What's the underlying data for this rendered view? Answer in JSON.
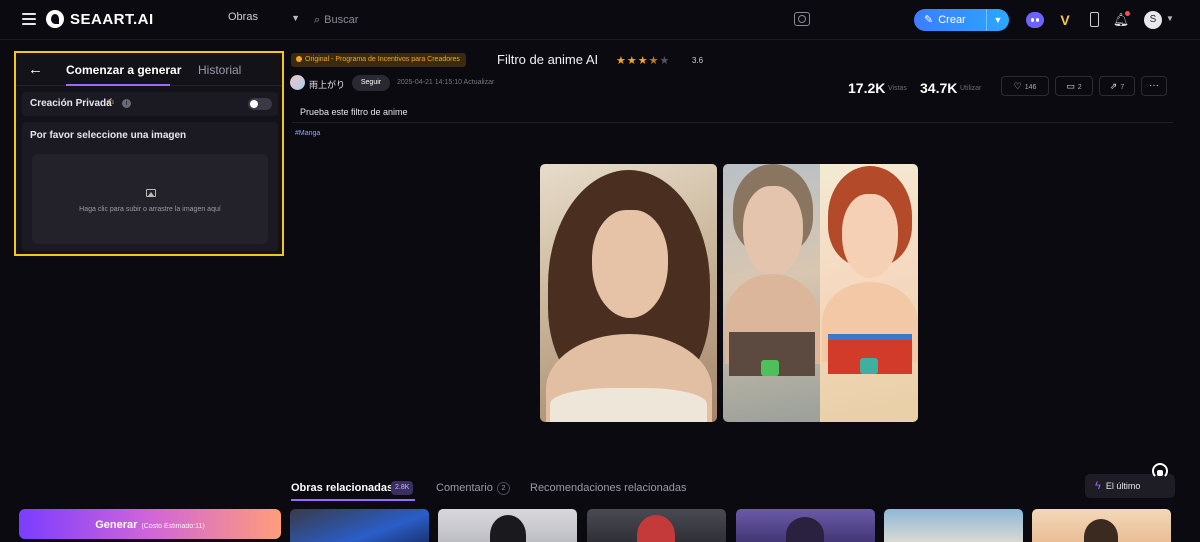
{
  "app": {
    "logo_text": "SEAART.AI"
  },
  "header": {
    "category": "Obras",
    "search_placeholder": "Buscar",
    "create_label": "Crear",
    "avatar_letter": "S"
  },
  "panel": {
    "tab_generate": "Comenzar a generar",
    "tab_history": "Historial",
    "private_label": "Creación Privada",
    "upload_title": "Por favor seleccione una imagen",
    "upload_hint": "Haga clic para subir o arrastre la imagen aquí",
    "generate_label": "Generar",
    "generate_cost": "(Costo Estimado:11)"
  },
  "post": {
    "badge": "Original - Programa de Incentivos para Creadores",
    "title": "Filtro de anime AI",
    "rating": "3.6",
    "rating_stars": 3.5,
    "author": "雨上がり",
    "follow_label": "Seguir",
    "updated": "2025-04-21 14:15:10 Actualizar",
    "views": "17.2K",
    "views_label": "Vistas",
    "uses": "34.7K",
    "uses_label": "Utilizar",
    "likes": "146",
    "comments": "2",
    "shares": "7",
    "description": "Prueba este filtro de anime",
    "tag": "#Manga"
  },
  "related": {
    "tab_related": "Obras relacionadas",
    "tab_related_count": "2.8K",
    "tab_comments": "Comentario",
    "tab_comments_count": "2",
    "tab_recs": "Recomendaciones relacionadas",
    "latest_label": "El último"
  },
  "colors": {
    "accent": "#9b6bff",
    "highlight_border": "#f5c518",
    "create_button": "#3b7dff",
    "star": "#f5a623"
  },
  "icons": [
    "menu-icon",
    "logo-icon",
    "search-icon",
    "camera-icon",
    "discord-icon",
    "vip-icon",
    "phone-icon",
    "bell-icon",
    "back-arrow-icon",
    "info-icon",
    "image-icon",
    "heart-icon",
    "comment-icon",
    "share-icon",
    "more-icon",
    "lightning-icon",
    "headset-icon"
  ]
}
